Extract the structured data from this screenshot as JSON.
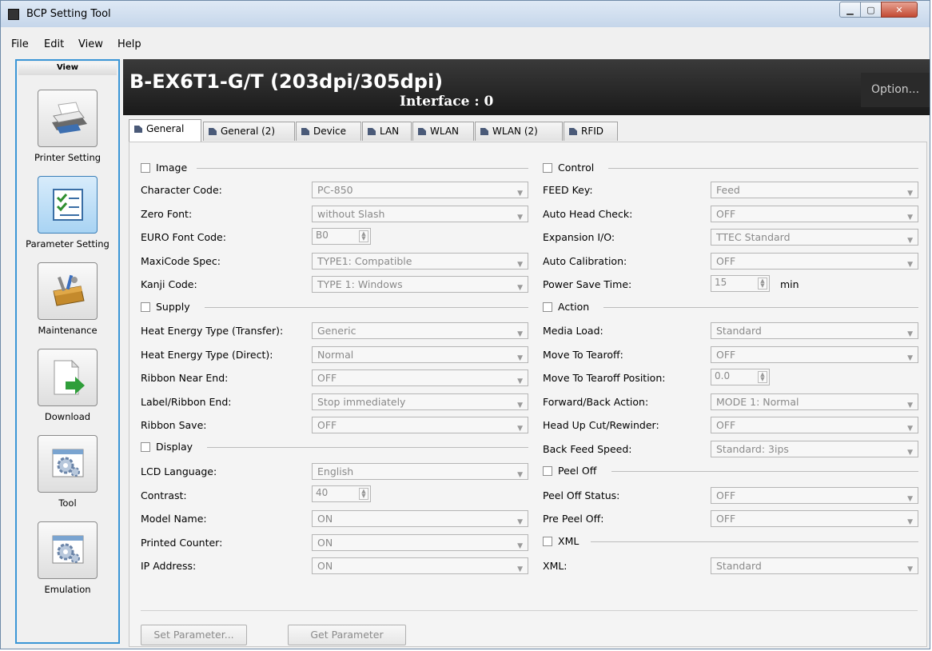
{
  "window": {
    "title": "BCP Setting Tool"
  },
  "menu": [
    {
      "label": "File"
    },
    {
      "label": "Edit"
    },
    {
      "label": "View"
    },
    {
      "label": "Help"
    }
  ],
  "sidebar": {
    "header": "View",
    "items": [
      {
        "label": "Printer Setting",
        "icon": "printer-icon"
      },
      {
        "label": "Parameter Setting",
        "icon": "checklist-icon",
        "active": true
      },
      {
        "label": "Maintenance",
        "icon": "toolbox-icon"
      },
      {
        "label": "Download",
        "icon": "download-icon"
      },
      {
        "label": "Tool",
        "icon": "gear-icon"
      },
      {
        "label": "Emulation",
        "icon": "gear-icon"
      }
    ]
  },
  "header": {
    "model": "B-EX6T1-G/T (203dpi/305dpi)",
    "interface": "Interface : 0",
    "option": "Option..."
  },
  "tabs": [
    {
      "label": "General",
      "active": true
    },
    {
      "label": "General (2)"
    },
    {
      "label": "Device"
    },
    {
      "label": "LAN"
    },
    {
      "label": "WLAN"
    },
    {
      "label": "WLAN (2)"
    },
    {
      "label": "RFID"
    }
  ],
  "left": {
    "image": {
      "title": "Image",
      "character_code": {
        "label": "Character Code:",
        "value": "PC-850"
      },
      "zero_font": {
        "label": "Zero Font:",
        "value": "without Slash"
      },
      "euro_font_code": {
        "label": "EURO Font Code:",
        "value": "B0"
      },
      "maxicode_spec": {
        "label": "MaxiCode Spec:",
        "value": "TYPE1: Compatible"
      },
      "kanji_code": {
        "label": "Kanji Code:",
        "value": "TYPE 1: Windows"
      }
    },
    "supply": {
      "title": "Supply",
      "heat_transfer": {
        "label": "Heat Energy Type (Transfer):",
        "value": "Generic"
      },
      "heat_direct": {
        "label": "Heat Energy Type (Direct):",
        "value": "Normal"
      },
      "ribbon_near_end": {
        "label": "Ribbon Near End:",
        "value": "OFF"
      },
      "label_ribbon_end": {
        "label": "Label/Ribbon End:",
        "value": "Stop immediately"
      },
      "ribbon_save": {
        "label": "Ribbon Save:",
        "value": "OFF"
      }
    },
    "display": {
      "title": "Display",
      "lcd_language": {
        "label": "LCD Language:",
        "value": "English"
      },
      "contrast": {
        "label": "Contrast:",
        "value": "40"
      },
      "model_name": {
        "label": "Model Name:",
        "value": "ON"
      },
      "printed_counter": {
        "label": "Printed Counter:",
        "value": "ON"
      },
      "ip_address": {
        "label": "IP Address:",
        "value": "ON"
      }
    }
  },
  "right": {
    "control": {
      "title": "Control",
      "feed_key": {
        "label": "FEED Key:",
        "value": "Feed"
      },
      "auto_head_check": {
        "label": "Auto Head Check:",
        "value": "OFF"
      },
      "expansion_io": {
        "label": "Expansion I/O:",
        "value": "TTEC Standard"
      },
      "auto_calibration": {
        "label": "Auto Calibration:",
        "value": "OFF"
      },
      "power_save_time": {
        "label": "Power Save Time:",
        "value": "15",
        "unit": "min"
      }
    },
    "action": {
      "title": "Action",
      "media_load": {
        "label": "Media Load:",
        "value": "Standard"
      },
      "move_to_tearoff": {
        "label": "Move To Tearoff:",
        "value": "OFF"
      },
      "move_to_tearoff_position": {
        "label": "Move To Tearoff Position:",
        "value": "0.0"
      },
      "forward_back_action": {
        "label": "Forward/Back Action:",
        "value": "MODE 1: Normal"
      },
      "head_up_cut": {
        "label": "Head Up Cut/Rewinder:",
        "value": "OFF"
      },
      "back_feed_speed": {
        "label": "Back Feed Speed:",
        "value": "Standard: 3ips"
      }
    },
    "peel_off": {
      "title": "Peel Off",
      "peel_off_status": {
        "label": "Peel Off Status:",
        "value": "OFF"
      },
      "pre_peel_off": {
        "label": "Pre Peel Off:",
        "value": "OFF"
      }
    },
    "xml": {
      "title": "XML",
      "xml": {
        "label": "XML:",
        "value": "Standard"
      }
    }
  },
  "buttons": {
    "set_parameter": "Set Parameter...",
    "get_parameter": "Get Parameter"
  }
}
